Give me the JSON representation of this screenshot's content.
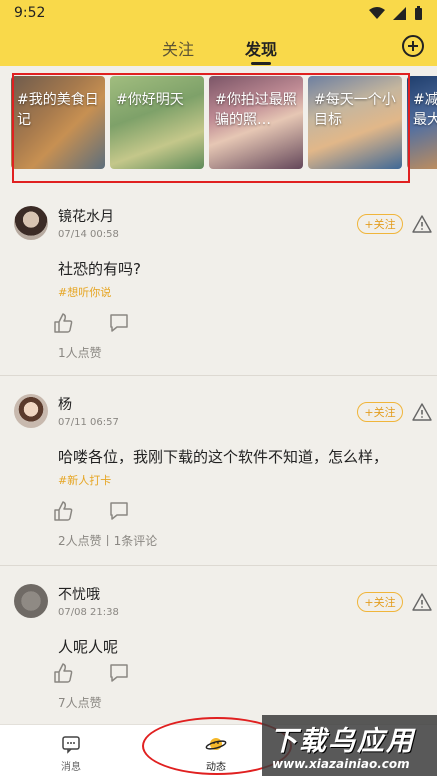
{
  "status_bar": {
    "time": "9:52"
  },
  "header": {
    "tabs": [
      {
        "label": "关注"
      },
      {
        "label": "发现",
        "active": true
      }
    ]
  },
  "topics": [
    {
      "label": "#我的美食日记"
    },
    {
      "label": "#你好明天"
    },
    {
      "label": "#你拍过最照骗的照…"
    },
    {
      "label": "#每天一个小目标"
    },
    {
      "label": "#减最大"
    }
  ],
  "posts": [
    {
      "name": "镜花水月",
      "time": "07/14 00:58",
      "follow_label": "+关注",
      "content": "社恐的有吗?",
      "tag": "#想听你说",
      "stats": "1人点赞"
    },
    {
      "name": "杨",
      "time": "07/11 06:57",
      "follow_label": "+关注",
      "content": "哈喽各位，我刚下载的这个软件不知道，怎么样，",
      "tag": "#新人打卡",
      "stats": "2人点赞丨1条评论"
    },
    {
      "name": "不忧哦",
      "time": "07/08 21:38",
      "follow_label": "+关注",
      "content": "人呢人呢",
      "tag": "",
      "stats": "7人点赞"
    }
  ],
  "bottom_nav": [
    {
      "label": "消息",
      "icon": "message-icon"
    },
    {
      "label": "动态",
      "icon": "planet-icon",
      "active": true
    }
  ],
  "watermark": {
    "main": "下载乌应用",
    "sub": "www.xiazainiao.com"
  },
  "colors": {
    "header_bg": "#f9d94a",
    "accent": "#e6a523",
    "annotation": "#e02020"
  }
}
